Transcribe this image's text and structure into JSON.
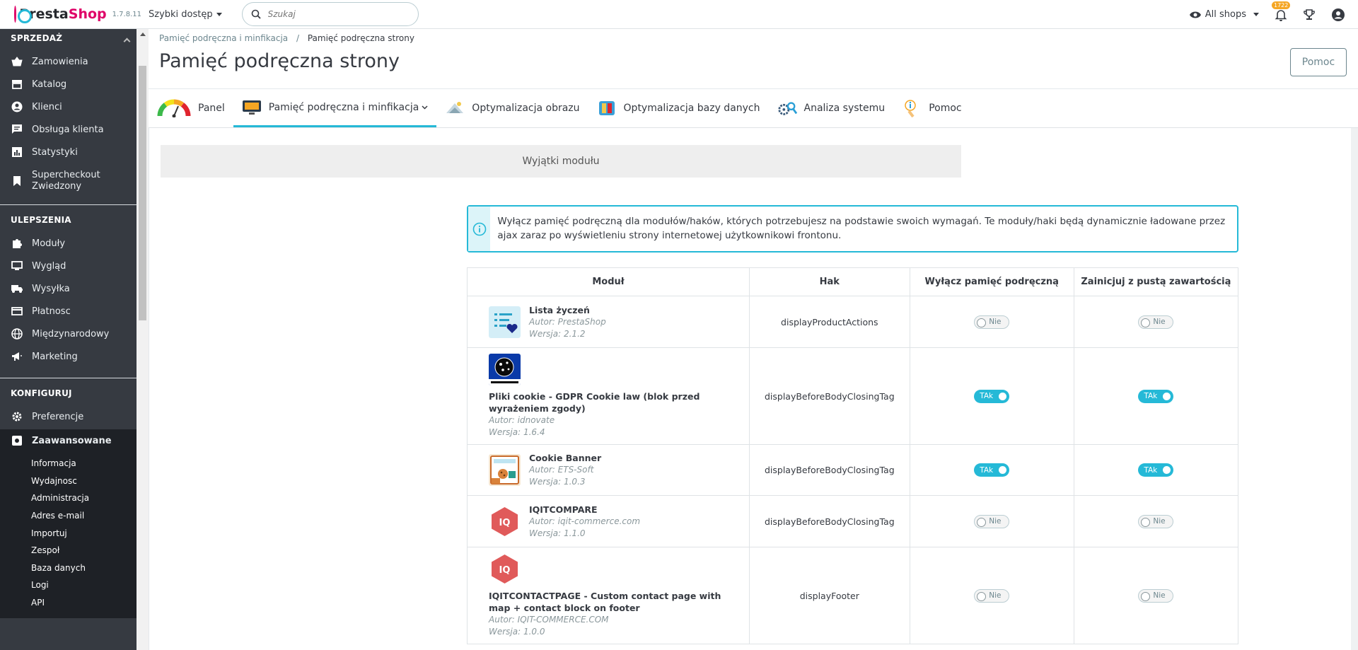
{
  "header": {
    "logo_text_a": "Presta",
    "logo_text_b": "Shop",
    "version": "1.7.8.11",
    "quick_access": "Szybki dostęp",
    "search_placeholder": "Szukaj",
    "all_shops": "All shops",
    "notifications_count": "1722"
  },
  "sidebar": {
    "sections": [
      {
        "title": "SPRZEDAŻ",
        "items": [
          "Zamowienia",
          "Katalog",
          "Klienci",
          "Obsługa klienta",
          "Statystyki",
          "Supercheckout Zwiedzony"
        ]
      },
      {
        "title": "ULEPSZENIA",
        "items": [
          "Moduły",
          "Wygląd",
          "Wysyłka",
          "Płatnosc",
          "Międzynarodowy",
          "Marketing"
        ]
      },
      {
        "title": "KONFIGURUJ",
        "items": [
          "Preferencje",
          "Zaawansowane"
        ]
      }
    ],
    "sub_items": [
      "Informacja",
      "Wydajnosc",
      "Administracja",
      "Adres e-mail",
      "Importuj",
      "Zespoł",
      "Baza danych",
      "Logi",
      "API"
    ]
  },
  "page": {
    "breadcrumb_parent": "Pamięć podręczna i minfikacja",
    "breadcrumb_sep": "/",
    "breadcrumb_current": "Pamięć podręczna strony",
    "title": "Pamięć podręczna strony",
    "help_button": "Pomoc"
  },
  "tabs": [
    {
      "label": "Panel"
    },
    {
      "label": "Pamięć podręczna i minfikacja"
    },
    {
      "label": "Optymalizacja obrazu"
    },
    {
      "label": "Optymalizacja bazy danych"
    },
    {
      "label": "Analiza systemu"
    },
    {
      "label": "Pomoc"
    }
  ],
  "panel": {
    "title": "Wyjątki modułu",
    "alert": "Wyłącz pamięć podręczną dla modułów/haków, których potrzebujesz na podstawie swoich wymagań. Te moduły/haki będą dynamicznie ładowane przez ajax zaraz po wyświetleniu strony internetowej użytkownikowi frontonu."
  },
  "table": {
    "headers": [
      "Moduł",
      "Hak",
      "Wyłącz pamięć podręczną",
      "Zainicjuj z pustą zawartością"
    ],
    "rows": [
      {
        "name": "Lista życzeń",
        "author": "Autor: PrestaShop",
        "version": "Wersja: 2.1.2",
        "hook": "displayProductActions",
        "disable": "Nie",
        "empty": "Nie"
      },
      {
        "name": "Pliki cookie - GDPR Cookie law (blok przed wyrażeniem zgody)",
        "author": "Autor: idnovate",
        "version": "Wersja: 1.6.4",
        "hook": "displayBeforeBodyClosingTag",
        "disable": "TAk",
        "empty": "TAk"
      },
      {
        "name": "Cookie Banner",
        "author": "Autor: ETS-Soft",
        "version": "Wersja: 1.0.3",
        "hook": "displayBeforeBodyClosingTag",
        "disable": "TAk",
        "empty": "TAk"
      },
      {
        "name": "IQITCOMPARE",
        "author": "Autor: iqit-commerce.com",
        "version": "Wersja: 1.1.0",
        "hook": "displayBeforeBodyClosingTag",
        "disable": "Nie",
        "empty": "Nie"
      },
      {
        "name": "IQITCONTACTPAGE - Custom contact page with map + contact block on footer",
        "author": "Autor: IQIT-COMMERCE.COM",
        "version": "Wersja: 1.0.0",
        "hook": "displayFooter",
        "disable": "Nie",
        "empty": "Nie"
      }
    ]
  },
  "colors": {
    "accent": "#25b9d7",
    "brand": "#df0067",
    "sidebar": "#363a41"
  }
}
